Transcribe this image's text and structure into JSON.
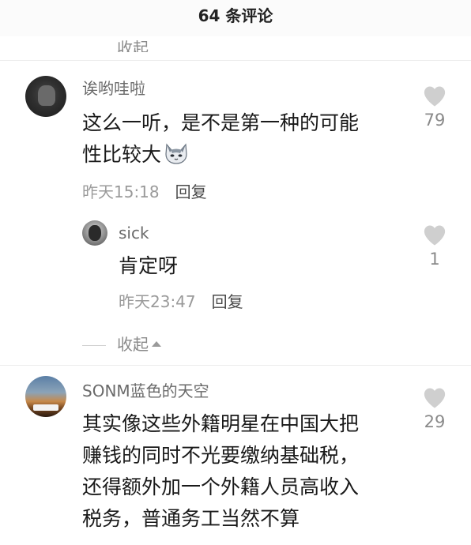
{
  "header": {
    "title": "64 条评论"
  },
  "top_collapse": {
    "label": "收起"
  },
  "comments": [
    {
      "username": "诶哟哇啦",
      "lines": [
        "这么一听，是不是第一种的可能",
        "性比较大"
      ],
      "emoji": "cat-emoji",
      "time": "昨天15:18",
      "reply_label": "回复",
      "likes": "79",
      "replies": [
        {
          "username": "sick",
          "lines": [
            "肯定呀"
          ],
          "time": "昨天23:47",
          "reply_label": "回复",
          "likes": "1"
        }
      ],
      "collapse_label": "收起"
    },
    {
      "username": "SONM蓝色的天空",
      "lines": [
        "其实像这些外籍明星在中国大把",
        "赚钱的同时不光要缴纳基础税，",
        "还得额外加一个外籍人员高收入",
        "税务，普通务工当然不算"
      ],
      "likes": "29"
    }
  ],
  "colors": {
    "username": "#6a6a6a",
    "meta": "#9a9a9a",
    "heart": "#cfcfcf"
  },
  "icons": {
    "like": "heart-icon",
    "collapse": "arrow-up-icon"
  }
}
